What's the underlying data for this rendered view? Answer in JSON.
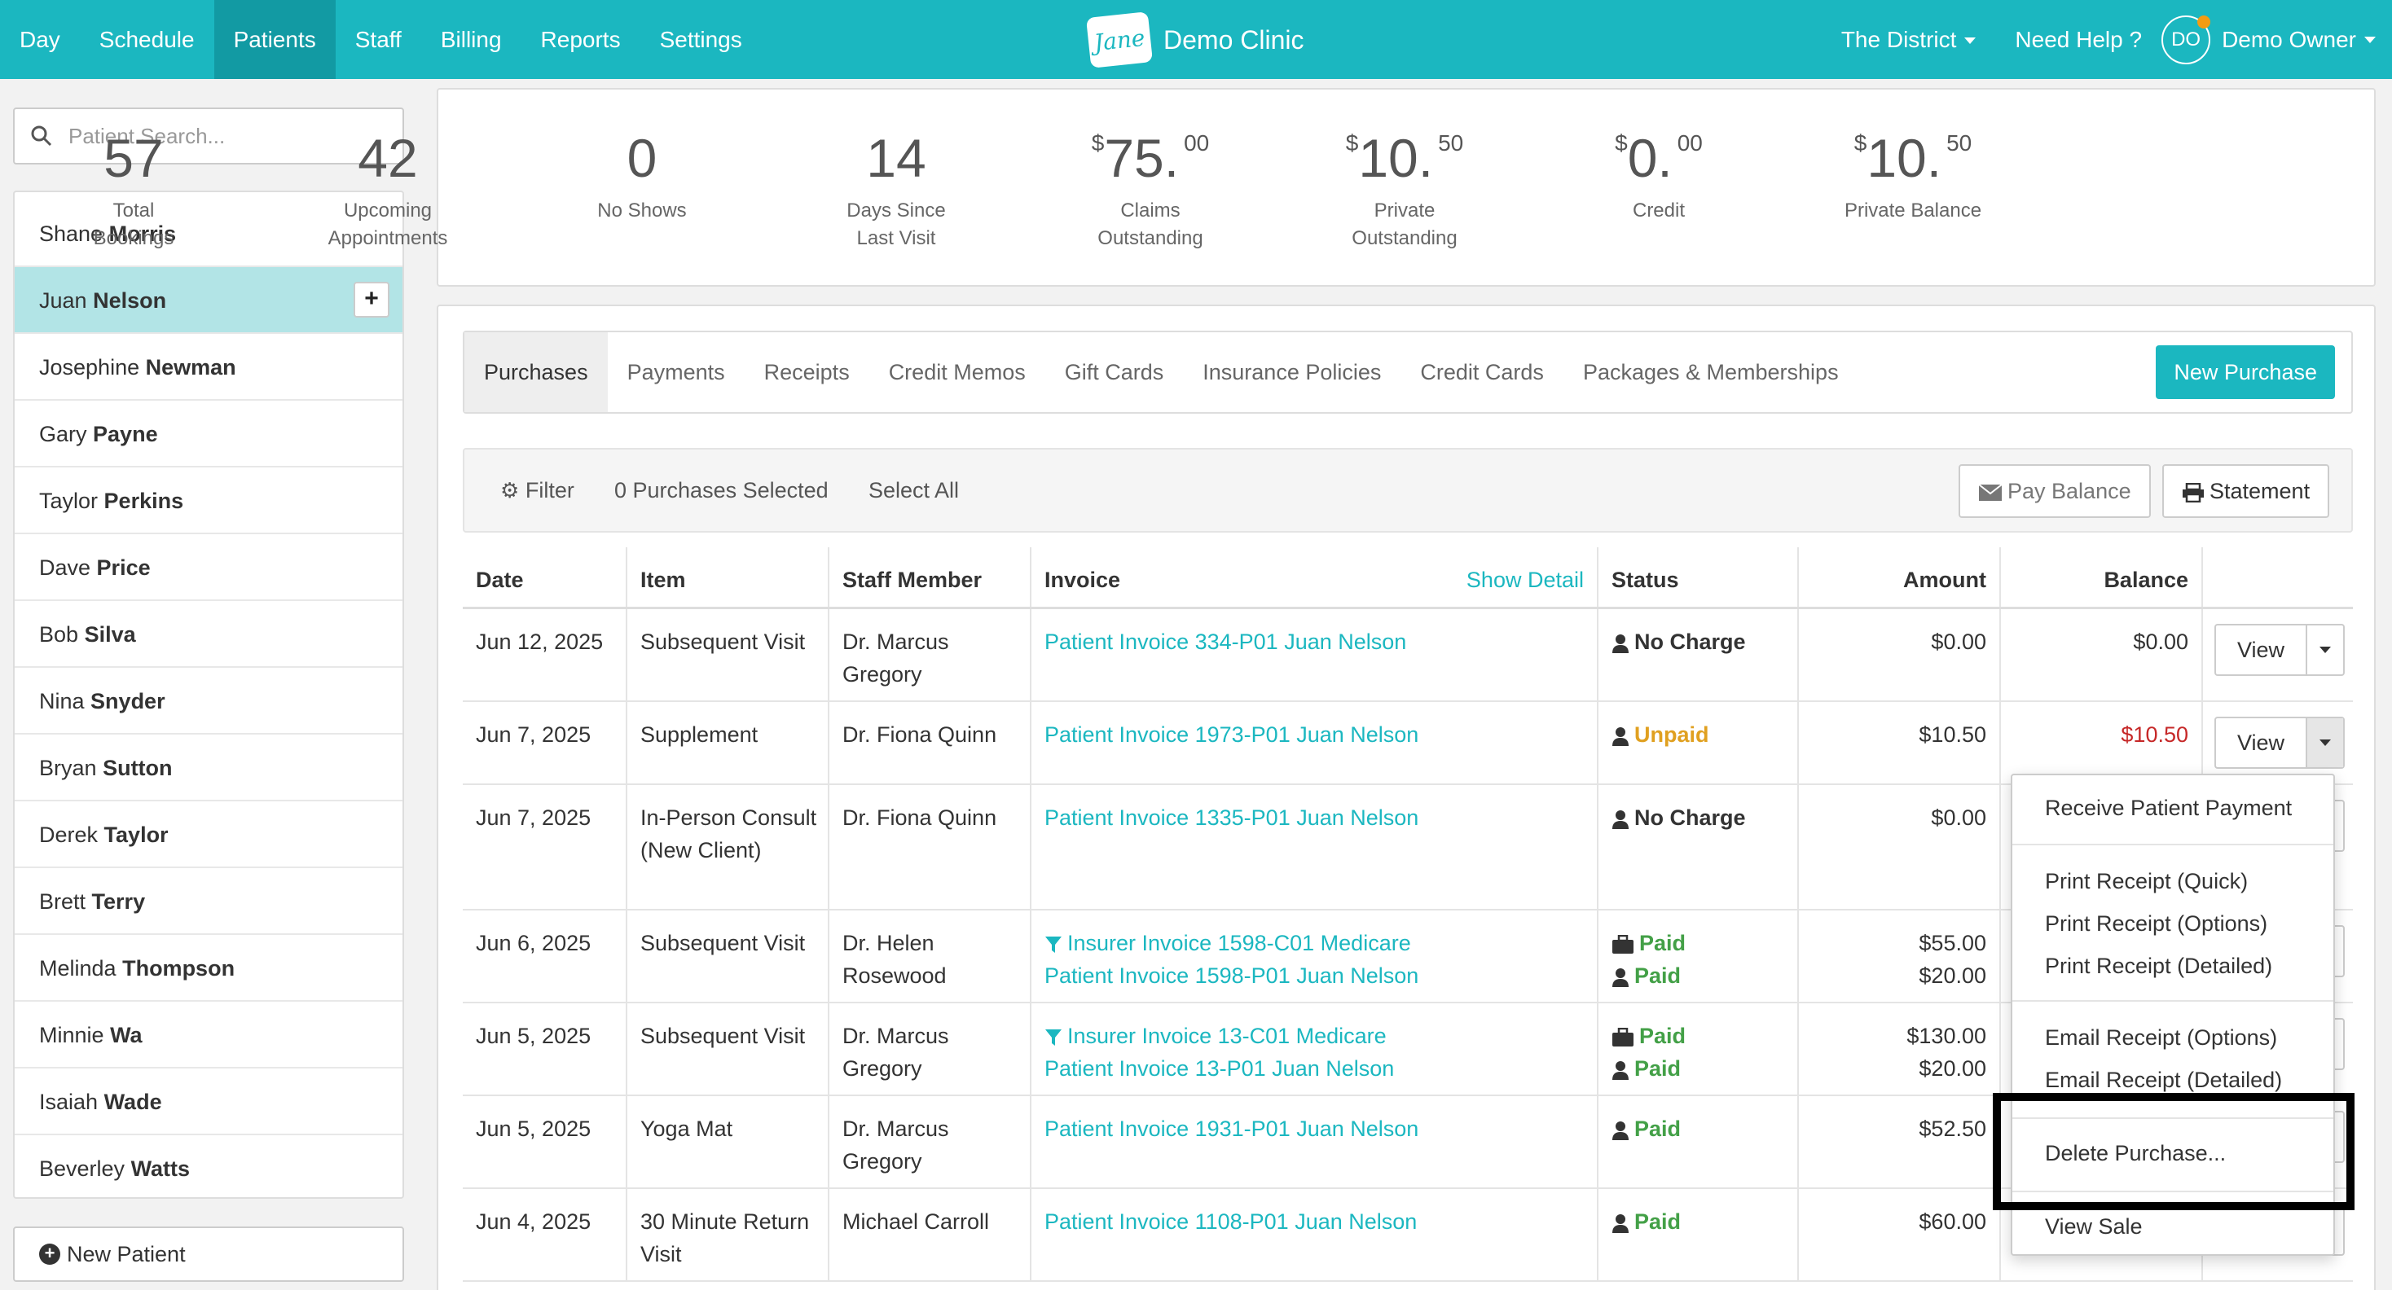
{
  "nav": {
    "items": [
      "Day",
      "Schedule",
      "Patients",
      "Staff",
      "Billing",
      "Reports",
      "Settings"
    ],
    "active": "Patients",
    "brand_logo": "Jane",
    "clinic_name": "Demo Clinic",
    "location": "The District",
    "help": "Need Help ?",
    "user_initials": "DO",
    "user_name": "Demo Owner"
  },
  "search": {
    "placeholder": "Patient Search..."
  },
  "patients": [
    {
      "first": "Shane",
      "last": "Morris"
    },
    {
      "first": "Juan",
      "last": "Nelson",
      "selected": true
    },
    {
      "first": "Josephine",
      "last": "Newman"
    },
    {
      "first": "Gary",
      "last": "Payne"
    },
    {
      "first": "Taylor",
      "last": "Perkins"
    },
    {
      "first": "Dave",
      "last": "Price"
    },
    {
      "first": "Bob",
      "last": "Silva"
    },
    {
      "first": "Nina",
      "last": "Snyder"
    },
    {
      "first": "Bryan",
      "last": "Sutton"
    },
    {
      "first": "Derek",
      "last": "Taylor"
    },
    {
      "first": "Brett",
      "last": "Terry"
    },
    {
      "first": "Melinda",
      "last": "Thompson"
    },
    {
      "first": "Minnie",
      "last": "Wa"
    },
    {
      "first": "Isaiah",
      "last": "Wade"
    },
    {
      "first": "Beverley",
      "last": "Watts"
    }
  ],
  "new_patient": "New Patient",
  "stats": [
    {
      "value": "57",
      "label": "Total\nBookings"
    },
    {
      "value": "42",
      "label": "Upcoming\nAppointments"
    },
    {
      "value": "0",
      "label": "No Shows"
    },
    {
      "value": "14",
      "label": "Days Since\nLast Visit"
    },
    {
      "currency": "$",
      "value": "75.",
      "cents": "00",
      "label": "Claims\nOutstanding"
    },
    {
      "currency": "$",
      "value": "10.",
      "cents": "50",
      "label": "Private\nOutstanding"
    },
    {
      "currency": "$",
      "value": "0.",
      "cents": "00",
      "label": "Credit"
    },
    {
      "currency": "$",
      "value": "10.",
      "cents": "50",
      "label": "Private Balance"
    }
  ],
  "tabs": [
    "Purchases",
    "Payments",
    "Receipts",
    "Credit Memos",
    "Gift Cards",
    "Insurance Policies",
    "Credit Cards",
    "Packages & Memberships"
  ],
  "active_tab": "Purchases",
  "new_purchase": "New Purchase",
  "toolbar": {
    "filter": "Filter",
    "selected": "0 Purchases Selected",
    "select_all": "Select All",
    "pay_balance": "Pay Balance",
    "statement": "Statement"
  },
  "table": {
    "headers": {
      "date": "Date",
      "item": "Item",
      "staff": "Staff Member",
      "invoice": "Invoice",
      "show_detail": "Show Detail",
      "status": "Status",
      "amount": "Amount",
      "balance": "Balance"
    },
    "view_label": "View",
    "rows": [
      {
        "date": "Jun 12, 2025",
        "item": "Subsequent Visit",
        "staff": "Dr. Marcus Gregory",
        "invoices": [
          {
            "text": "Patient Invoice 334-P01 Juan Nelson",
            "insurer": false
          }
        ],
        "statuses": [
          {
            "text": "No Charge",
            "kind": "nocharge",
            "icon": "person"
          }
        ],
        "amounts": [
          "$0.00"
        ],
        "balance": "$0.00",
        "balance_red": false
      },
      {
        "date": "Jun 7, 2025",
        "item": "Supplement",
        "staff": "Dr. Fiona Quinn",
        "invoices": [
          {
            "text": "Patient Invoice 1973-P01 Juan Nelson",
            "insurer": false
          }
        ],
        "statuses": [
          {
            "text": "Unpaid",
            "kind": "unpaid",
            "icon": "person"
          }
        ],
        "amounts": [
          "$10.50"
        ],
        "balance": "$10.50",
        "balance_red": true
      },
      {
        "date": "Jun 7, 2025",
        "item": "In-Person Consult (New Client)",
        "staff": "Dr. Fiona Quinn",
        "invoices": [
          {
            "text": "Patient Invoice 1335-P01 Juan Nelson",
            "insurer": false
          }
        ],
        "statuses": [
          {
            "text": "No Charge",
            "kind": "nocharge",
            "icon": "person"
          }
        ],
        "amounts": [
          "$0.00"
        ],
        "balance": "",
        "balance_red": false
      },
      {
        "date": "Jun 6, 2025",
        "item": "Subsequent Visit",
        "staff": "Dr. Helen Rosewood",
        "invoices": [
          {
            "text": "Insurer Invoice 1598-C01 Medicare",
            "insurer": true
          },
          {
            "text": "Patient Invoice 1598-P01 Juan Nelson",
            "insurer": false
          }
        ],
        "statuses": [
          {
            "text": "Paid",
            "kind": "paid",
            "icon": "case"
          },
          {
            "text": "Paid",
            "kind": "paid",
            "icon": "person"
          }
        ],
        "amounts": [
          "$55.00",
          "$20.00"
        ],
        "balance": "",
        "balance_red": false
      },
      {
        "date": "Jun 5, 2025",
        "item": "Subsequent Visit",
        "staff": "Dr. Marcus Gregory",
        "invoices": [
          {
            "text": "Insurer Invoice 13-C01 Medicare",
            "insurer": true
          },
          {
            "text": "Patient Invoice 13-P01 Juan Nelson",
            "insurer": false
          }
        ],
        "statuses": [
          {
            "text": "Paid",
            "kind": "paid",
            "icon": "case"
          },
          {
            "text": "Paid",
            "kind": "paid",
            "icon": "person"
          }
        ],
        "amounts": [
          "$130.00",
          "$20.00"
        ],
        "balance": "",
        "balance_red": false
      },
      {
        "date": "Jun 5, 2025",
        "item": "Yoga Mat",
        "staff": "Dr. Marcus Gregory",
        "invoices": [
          {
            "text": "Patient Invoice 1931-P01 Juan Nelson",
            "insurer": false
          }
        ],
        "statuses": [
          {
            "text": "Paid",
            "kind": "paid",
            "icon": "person"
          }
        ],
        "amounts": [
          "$52.50"
        ],
        "balance": "",
        "balance_red": false
      },
      {
        "date": "Jun 4, 2025",
        "item": "30 Minute Return Visit",
        "staff": "Michael Carroll",
        "invoices": [
          {
            "text": "Patient Invoice 1108-P01 Juan Nelson",
            "insurer": false
          }
        ],
        "statuses": [
          {
            "text": "Paid",
            "kind": "paid",
            "icon": "person"
          }
        ],
        "amounts": [
          "$60.00"
        ],
        "balance": "",
        "balance_red": false
      }
    ]
  },
  "dropdown": {
    "items": [
      "Receive Patient Payment",
      "Print Receipt (Quick)",
      "Print Receipt (Options)",
      "Print Receipt (Detailed)",
      "Email Receipt (Options)",
      "Email Receipt (Detailed)",
      "Delete Purchase...",
      "View Sale"
    ]
  },
  "colors": {
    "brand": "#1bb7c0",
    "paid": "#43a047",
    "unpaid": "#e0a020",
    "balance_due": "#c62828",
    "highlight": "#000000"
  }
}
